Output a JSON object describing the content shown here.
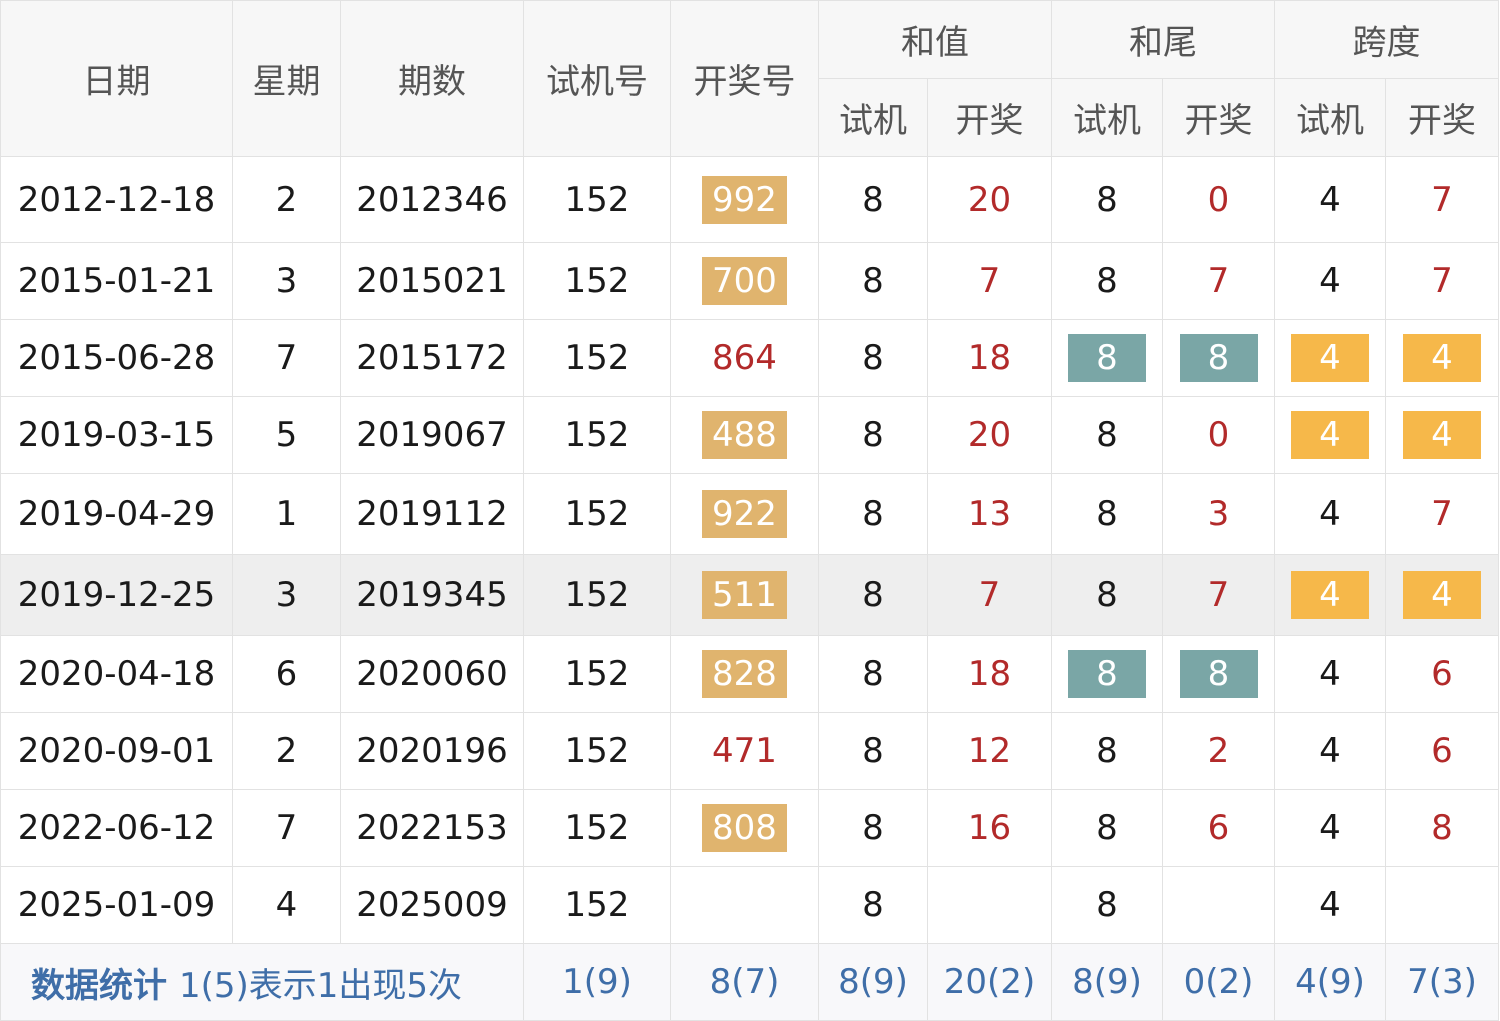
{
  "headers": {
    "date": "日期",
    "weekday": "星期",
    "issue": "期数",
    "trial": "试机号",
    "draw": "开奖号",
    "sum": "和值",
    "tail": "和尾",
    "span": "跨度",
    "sub_trial": "试机",
    "sub_draw": "开奖"
  },
  "rows": [
    {
      "date": "2012-12-18",
      "weekday": "2",
      "issue": "2012346",
      "trial": "152",
      "draw": "992",
      "draw_hl": "tan",
      "sum_trial": "8",
      "sum_draw": "20",
      "tail_trial": "8",
      "tail_trial_hl": "",
      "tail_draw": "0",
      "tail_draw_hl": "",
      "span_trial": "4",
      "span_trial_hl": "",
      "span_draw": "7",
      "span_draw_hl": ""
    },
    {
      "date": "2015-01-21",
      "weekday": "3",
      "issue": "2015021",
      "trial": "152",
      "draw": "700",
      "draw_hl": "tan",
      "sum_trial": "8",
      "sum_draw": "7",
      "tail_trial": "8",
      "tail_trial_hl": "",
      "tail_draw": "7",
      "tail_draw_hl": "",
      "span_trial": "4",
      "span_trial_hl": "",
      "span_draw": "7",
      "span_draw_hl": ""
    },
    {
      "date": "2015-06-28",
      "weekday": "7",
      "issue": "2015172",
      "trial": "152",
      "draw": "864",
      "draw_hl": "",
      "sum_trial": "8",
      "sum_draw": "18",
      "tail_trial": "8",
      "tail_trial_hl": "teal",
      "tail_draw": "8",
      "tail_draw_hl": "teal",
      "span_trial": "4",
      "span_trial_hl": "orange",
      "span_draw": "4",
      "span_draw_hl": "orange"
    },
    {
      "date": "2019-03-15",
      "weekday": "5",
      "issue": "2019067",
      "trial": "152",
      "draw": "488",
      "draw_hl": "tan",
      "sum_trial": "8",
      "sum_draw": "20",
      "tail_trial": "8",
      "tail_trial_hl": "",
      "tail_draw": "0",
      "tail_draw_hl": "",
      "span_trial": "4",
      "span_trial_hl": "orange",
      "span_draw": "4",
      "span_draw_hl": "orange"
    },
    {
      "date": "2019-04-29",
      "weekday": "1",
      "issue": "2019112",
      "trial": "152",
      "draw": "922",
      "draw_hl": "tan",
      "sum_trial": "8",
      "sum_draw": "13",
      "tail_trial": "8",
      "tail_trial_hl": "",
      "tail_draw": "3",
      "tail_draw_hl": "",
      "span_trial": "4",
      "span_trial_hl": "",
      "span_draw": "7",
      "span_draw_hl": ""
    },
    {
      "date": "2019-12-25",
      "weekday": "3",
      "issue": "2019345",
      "trial": "152",
      "draw": "511",
      "draw_hl": "tan",
      "sum_trial": "8",
      "sum_draw": "7",
      "tail_trial": "8",
      "tail_trial_hl": "",
      "tail_draw": "7",
      "tail_draw_hl": "",
      "span_trial": "4",
      "span_trial_hl": "orange",
      "span_draw": "4",
      "span_draw_hl": "orange"
    },
    {
      "date": "2020-04-18",
      "weekday": "6",
      "issue": "2020060",
      "trial": "152",
      "draw": "828",
      "draw_hl": "tan",
      "sum_trial": "8",
      "sum_draw": "18",
      "tail_trial": "8",
      "tail_trial_hl": "teal",
      "tail_draw": "8",
      "tail_draw_hl": "teal",
      "span_trial": "4",
      "span_trial_hl": "",
      "span_draw": "6",
      "span_draw_hl": ""
    },
    {
      "date": "2020-09-01",
      "weekday": "2",
      "issue": "2020196",
      "trial": "152",
      "draw": "471",
      "draw_hl": "",
      "sum_trial": "8",
      "sum_draw": "12",
      "tail_trial": "8",
      "tail_trial_hl": "",
      "tail_draw": "2",
      "tail_draw_hl": "",
      "span_trial": "4",
      "span_trial_hl": "",
      "span_draw": "6",
      "span_draw_hl": ""
    },
    {
      "date": "2022-06-12",
      "weekday": "7",
      "issue": "2022153",
      "trial": "152",
      "draw": "808",
      "draw_hl": "tan",
      "sum_trial": "8",
      "sum_draw": "16",
      "tail_trial": "8",
      "tail_trial_hl": "",
      "tail_draw": "6",
      "tail_draw_hl": "",
      "span_trial": "4",
      "span_trial_hl": "",
      "span_draw": "8",
      "span_draw_hl": ""
    },
    {
      "date": "2025-01-09",
      "weekday": "4",
      "issue": "2025009",
      "trial": "152",
      "draw": "",
      "draw_hl": "",
      "sum_trial": "8",
      "sum_draw": "",
      "tail_trial": "8",
      "tail_trial_hl": "",
      "tail_draw": "",
      "tail_draw_hl": "",
      "span_trial": "4",
      "span_trial_hl": "",
      "span_draw": "",
      "span_draw_hl": ""
    }
  ],
  "hover_row_index": 5,
  "colors": {
    "draw_highlight": "#e0b46e",
    "tail_match": "#7aa6a6",
    "span_match": "#f6b84a",
    "red_text": "#b22a2a",
    "stats_text": "#3f6ea8"
  },
  "stats": {
    "label": "数据统计",
    "note": "1(5)表示1出现5次",
    "trial": "1(9)",
    "draw": "8(7)",
    "sum_trial": "8(9)",
    "sum_draw": "20(2)",
    "tail_trial": "8(9)",
    "tail_draw": "0(2)",
    "span_trial": "4(9)",
    "span_draw": "7(3)"
  }
}
